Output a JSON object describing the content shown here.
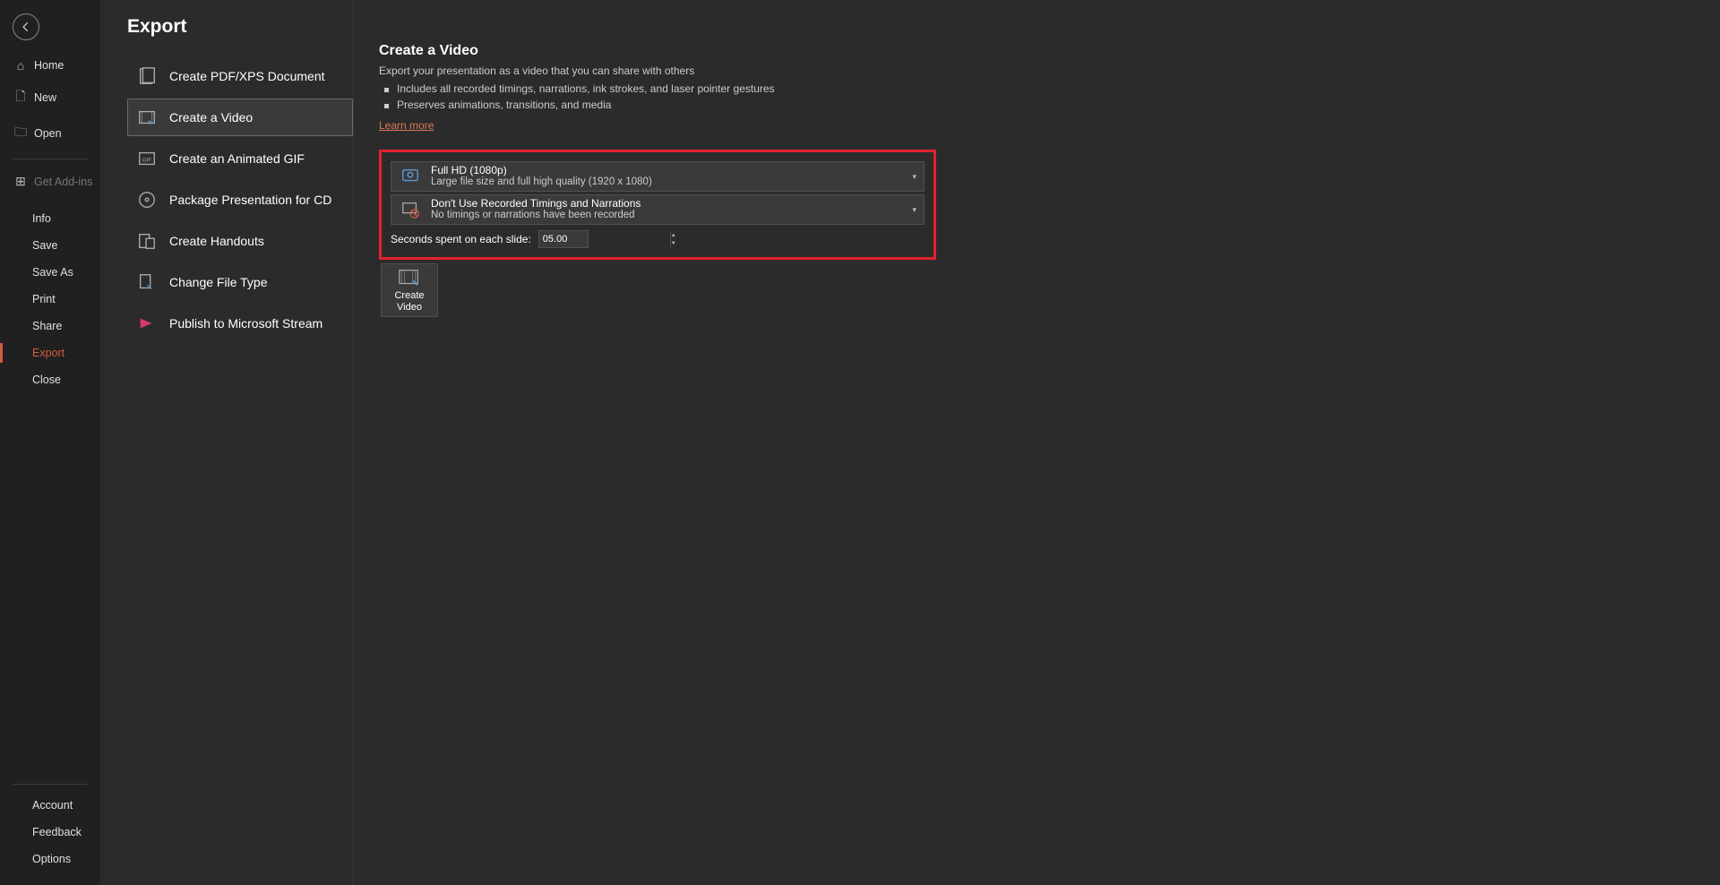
{
  "sidebar": {
    "home": "Home",
    "new": "New",
    "open": "Open",
    "get_addins": "Get Add-ins",
    "info": "Info",
    "save": "Save",
    "save_as": "Save As",
    "print": "Print",
    "share": "Share",
    "export": "Export",
    "close": "Close",
    "account": "Account",
    "feedback": "Feedback",
    "options": "Options"
  },
  "panel": {
    "title": "Export",
    "options": {
      "pdf": "Create PDF/XPS Document",
      "video": "Create a Video",
      "gif": "Create an Animated GIF",
      "cd": "Package Presentation for CD",
      "handouts": "Create Handouts",
      "filetype": "Change File Type",
      "stream": "Publish to Microsoft Stream"
    }
  },
  "detail": {
    "heading": "Create a Video",
    "subtitle": "Export your presentation as a video that you can share with others",
    "bullet1": "Includes all recorded timings, narrations, ink strokes, and laser pointer gestures",
    "bullet2": "Preserves animations, transitions, and media",
    "learn": "Learn more",
    "quality": {
      "title": "Full HD (1080p)",
      "desc": "Large file size and full high quality (1920 x 1080)"
    },
    "timings": {
      "title": "Don't Use Recorded Timings and Narrations",
      "desc": "No timings or narrations have been recorded"
    },
    "seconds_label": "Seconds spent on each slide:",
    "seconds_value": "05.00",
    "create_label": "Create\nVideo"
  }
}
